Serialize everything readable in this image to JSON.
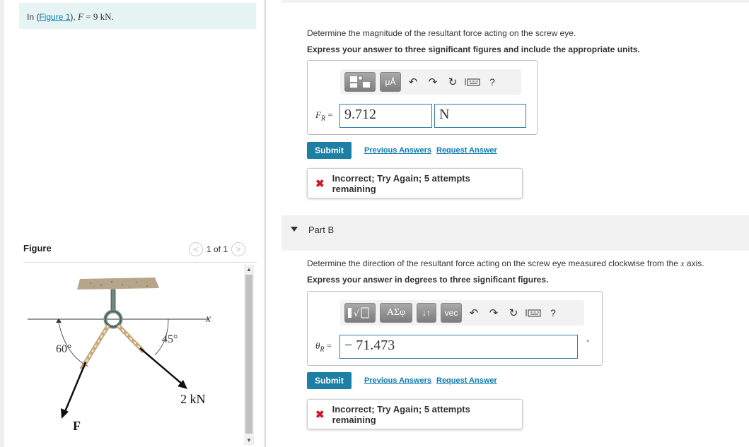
{
  "problem": {
    "intro_prefix": "In (",
    "figure_link": "Figure 1",
    "intro_suffix": "), ",
    "force_var": "F",
    "force_eq": " = 9 kN."
  },
  "figure": {
    "title": "Figure",
    "pager": "1 of 1",
    "prev_glyph": "<",
    "next_glyph": ">",
    "label_x": "x",
    "label_60": "60°",
    "label_45": "45°",
    "label_2kn": "2 kN",
    "label_F": "F"
  },
  "partA": {
    "question": "Determine the magnitude of the resultant force acting on the screw eye.",
    "instruction": "Express your answer to three significant figures and include the appropriate units.",
    "label_var": "F",
    "label_sub": "R",
    "label_eq": " =",
    "value": "9.712",
    "unit": "N",
    "toolbar": {
      "units_label": "μÅ",
      "help": "?"
    },
    "submit": "Submit",
    "previous_answers": "Previous Answers",
    "request_answer": "Request Answer",
    "feedback": "Incorrect; Try Again; 5 attempts remaining"
  },
  "partB": {
    "title": "Part B",
    "question_prefix": "Determine the direction of the resultant force acting on the screw eye measured clockwise from the ",
    "question_var": "x",
    "question_suffix": " axis.",
    "instruction": "Express your answer in degrees to three significant figures.",
    "label_var": "θ",
    "label_sub": "R",
    "label_eq": " =",
    "value": "− 71.473",
    "unit": "°",
    "toolbar": {
      "sym_label": "ΑΣφ",
      "arrows_label": "↓↑",
      "vec_label": "vec",
      "help": "?"
    },
    "submit": "Submit",
    "previous_answers": "Previous Answers",
    "request_answer": "Request Answer",
    "feedback": "Incorrect; Try Again; 5 attempts remaining"
  },
  "colors": {
    "accent": "#1d7fa3",
    "link": "#0b7bb0",
    "error": "#d0182e",
    "info_bg": "#e6f4f4"
  }
}
